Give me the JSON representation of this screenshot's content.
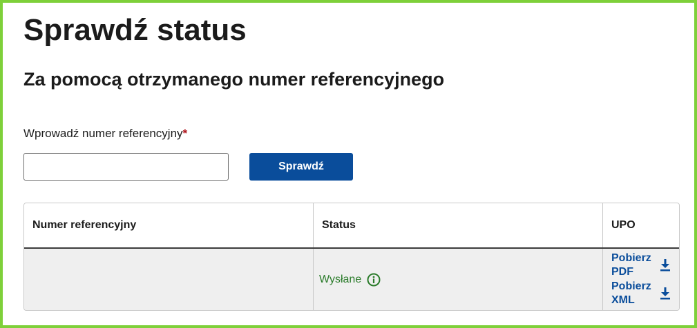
{
  "header": {
    "title": "Sprawdź status",
    "subtitle": "Za pomocą otrzymanego numer referencyjnego"
  },
  "form": {
    "label": "Wprowadź numer referencyjny",
    "required_mark": "*",
    "input_value": "",
    "input_placeholder": "",
    "submit_label": "Sprawdź"
  },
  "table": {
    "headers": [
      "Numer referencyjny",
      "Status",
      "UPO"
    ],
    "rows": [
      {
        "reference_number": "",
        "status": "Wysłane",
        "status_icon": "info-icon",
        "links": [
          {
            "label": "Pobierz PDF",
            "icon": "download-icon"
          },
          {
            "label": "Pobierz XML",
            "icon": "download-icon"
          }
        ]
      }
    ]
  },
  "colors": {
    "frame_border": "#7ed03a",
    "primary_button": "#0a4d9b",
    "link": "#0a4d9b",
    "status_ok": "#2a7b2a",
    "required": "#b0161e",
    "row_bg": "#efefef"
  }
}
